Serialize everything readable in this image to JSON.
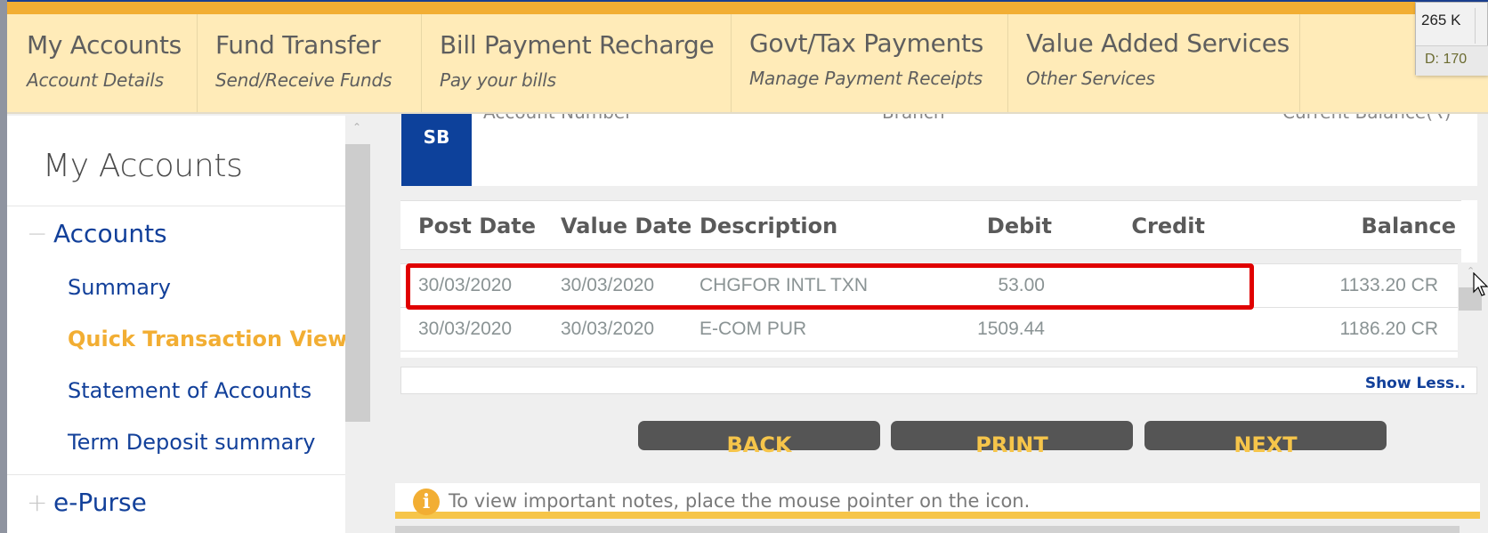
{
  "nav": {
    "items": [
      {
        "title": "My Accounts",
        "subtitle": "Account Details"
      },
      {
        "title": "Fund Transfer",
        "subtitle": "Send/Receive Funds"
      },
      {
        "title": "Bill Payment Recharge",
        "subtitle": "Pay your bills"
      },
      {
        "title": "Govt/Tax Payments",
        "subtitle": "Manage Payment Receipts"
      },
      {
        "title": "Value Added Services",
        "subtitle": "Other Services"
      }
    ]
  },
  "popup": {
    "size": "265 K",
    "d_value": "D: 170"
  },
  "sidebar": {
    "title": "My Accounts",
    "groups": [
      {
        "symbol": "−",
        "label": "Accounts",
        "expanded": true
      },
      {
        "symbol": "+",
        "label": "e-Purse",
        "expanded": false
      }
    ],
    "items": [
      {
        "label": "Summary",
        "active": false
      },
      {
        "label": "Quick Transaction View",
        "active": true
      },
      {
        "label": "Statement of Accounts",
        "active": false
      },
      {
        "label": "Term Deposit summary",
        "active": false
      }
    ]
  },
  "account": {
    "badge": "SB",
    "clipped_labels": [
      "Account Number",
      "Branch",
      "Current Balance(₹)"
    ]
  },
  "transactions": {
    "columns": [
      "Post Date",
      "Value Date",
      "Description",
      "Debit",
      "Credit",
      "Balance"
    ],
    "rows": [
      {
        "post_date": "30/03/2020",
        "value_date": "30/03/2020",
        "description": "CHGFOR INTL TXN",
        "debit": "53.00",
        "credit": "",
        "balance": "1133.20 CR",
        "highlighted": true
      },
      {
        "post_date": "30/03/2020",
        "value_date": "30/03/2020",
        "description": "E-COM PUR",
        "debit": "1509.44",
        "credit": "",
        "balance": "1186.20 CR",
        "highlighted": false
      }
    ],
    "show_less": "Show Less.."
  },
  "buttons": {
    "back": "BACK",
    "print": "PRINT",
    "next": "NEXT"
  },
  "notes": {
    "icon": "i",
    "text": "To view important notes, place the mouse pointer on the icon."
  },
  "colors": {
    "accent_orange": "#f2ae33",
    "brand_blue": "#0d419b",
    "highlight_red": "#e00000",
    "button_text": "#f6c54a"
  }
}
